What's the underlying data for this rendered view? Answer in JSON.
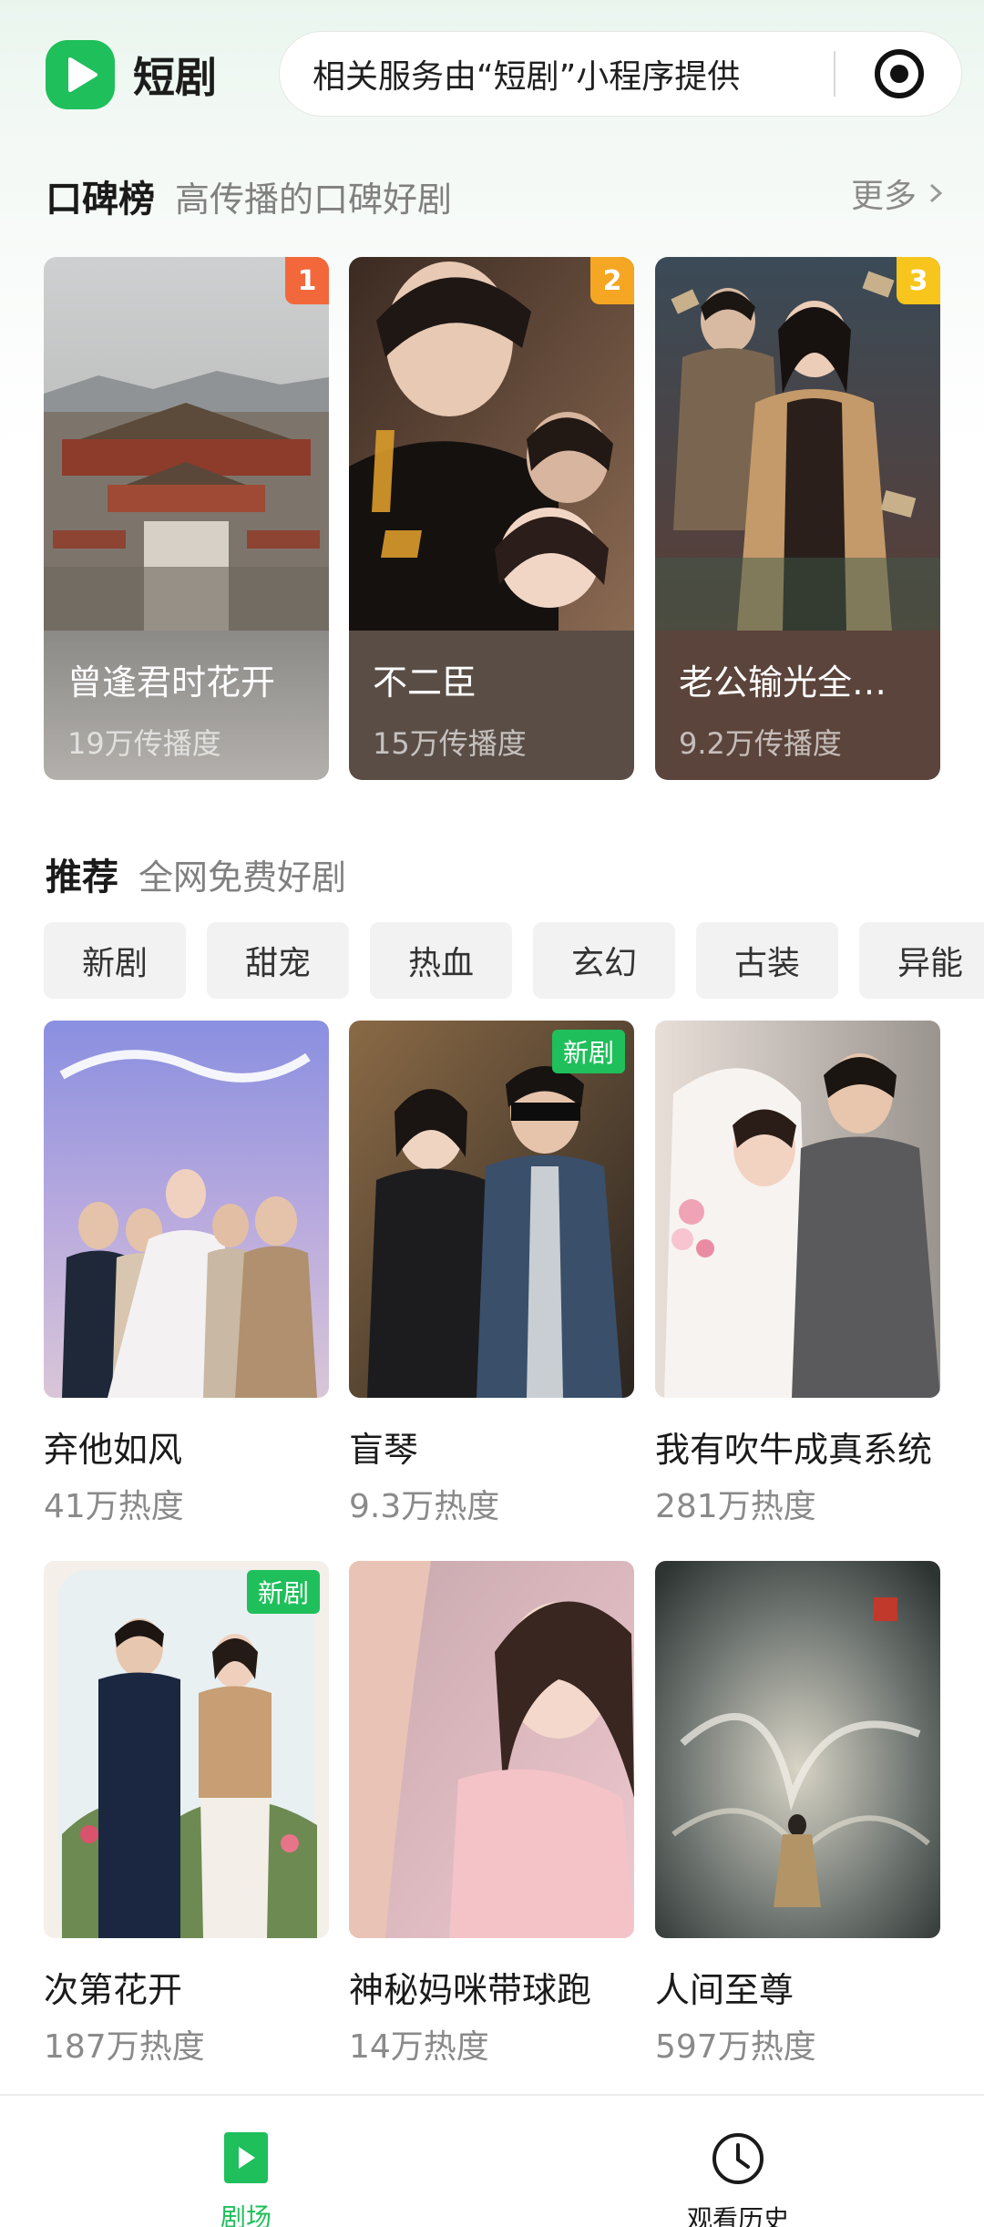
{
  "header": {
    "brand_name": "短剧",
    "service_text": "相关服务由“短剧”小程序提供"
  },
  "ranking": {
    "title": "口碑榜",
    "subtitle": "高传播的口碑好剧",
    "more_label": "更多",
    "items": [
      {
        "rank": "1",
        "title": "曾逢君时花开",
        "meta": "19万传播度",
        "badge_color": "#f2683b",
        "info_color": "#8c8a87"
      },
      {
        "rank": "2",
        "title": "不二臣",
        "meta": "15万传播度",
        "badge_color": "#f5a623",
        "info_color": "#5a4d46"
      },
      {
        "rank": "3",
        "title": "老公输光全部家产，我让他继续",
        "meta": "9.2万传播度",
        "badge_color": "#f8c51c",
        "info_color": "#5b443b"
      }
    ]
  },
  "recommend": {
    "title": "推荐",
    "subtitle": "全网免费好剧",
    "tags": [
      "新剧",
      "甜宠",
      "热血",
      "玄幻",
      "古装",
      "异能"
    ],
    "new_badge_label": "新剧",
    "items": [
      {
        "title": "弃他如风",
        "meta": "41万热度",
        "is_new": false
      },
      {
        "title": "盲琴",
        "meta": "9.3万热度",
        "is_new": true
      },
      {
        "title": "我有吹牛成真系统",
        "meta": "281万热度",
        "is_new": false
      },
      {
        "title": "次第花开",
        "meta": "187万热度",
        "is_new": true
      },
      {
        "title": "神秘妈咪带球跑",
        "meta": "14万热度",
        "is_new": false
      },
      {
        "title": "人间至尊",
        "meta": "597万热度",
        "is_new": false
      }
    ]
  },
  "tabbar": {
    "items": [
      {
        "label": "剧场",
        "icon": "play-icon",
        "active": true
      },
      {
        "label": "观看历史",
        "icon": "clock-icon",
        "active": false
      }
    ]
  },
  "colors": {
    "accent": "#1fbf5b",
    "text_secondary": "#8a8a8a"
  }
}
